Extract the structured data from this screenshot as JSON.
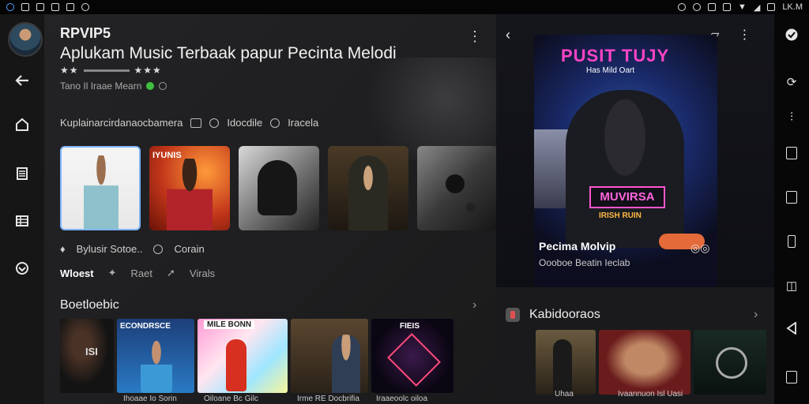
{
  "status_bar": {
    "left_icons": [
      "app-icon",
      "photo-icon",
      "image-icon",
      "doc-icon",
      "cast-icon",
      "download-icon"
    ],
    "right_icons": [
      "vibrate-icon",
      "alarm-icon",
      "grid-icon",
      "nfc-icon",
      "wifi-icon",
      "signal-icon",
      "battery-icon"
    ],
    "time": "LK.M"
  },
  "app": {
    "name": "RPVIP5",
    "title": "Aplukam Music Terbaak papur Pecinta Melodi",
    "rating_stars": "★★ ★★★",
    "meta": "Tano Il Iraae Mearn"
  },
  "filters": {
    "label": "Kuplainarcirdanaocbamera",
    "chip1": "Idocdile",
    "chip2": "Iracela"
  },
  "thumbnails": [
    {
      "label": ""
    },
    {
      "label": "IYUNIS"
    },
    {
      "label": ""
    },
    {
      "label": ""
    },
    {
      "label": ""
    }
  ],
  "share": {
    "label": "Bylusir Sotoe..",
    "chip": "Corain"
  },
  "actions": {
    "first": "Wloest",
    "second": "Raet",
    "third": "Virals"
  },
  "section2": {
    "title": "Boetloebic"
  },
  "albums": [
    {
      "title": "ISI",
      "caption": ""
    },
    {
      "title": "ECONDRSCE",
      "caption": "Ihoaae Io Sorin"
    },
    {
      "title": "MILE BONN",
      "caption": "Oiloane Bc Gilc"
    },
    {
      "title": "",
      "caption": "Irme RE Docbrifia"
    },
    {
      "title": "FIEIS",
      "caption": "Iraaeoolc oiloa"
    }
  ],
  "player": {
    "cover_title": "PUSIT TUJY",
    "cover_subtitle": "Has Mild Oart",
    "cover_plate": "MUVIRSA",
    "cover_plate_sub": "IRISH RUIN",
    "track_title": "Pecima Molvip",
    "track_artist": "Oooboe Beatin Ieclab"
  },
  "section3": {
    "title": "Kabidooraos"
  },
  "right_thumbs": [
    {
      "caption": "Uhaa"
    },
    {
      "caption": "Ivaannuon Isl Uasi"
    },
    {
      "caption": ""
    }
  ],
  "colors": {
    "background": "#1c1c1e",
    "accent_pink": "#ff44c6",
    "accent_blue": "#7fb6ff"
  }
}
